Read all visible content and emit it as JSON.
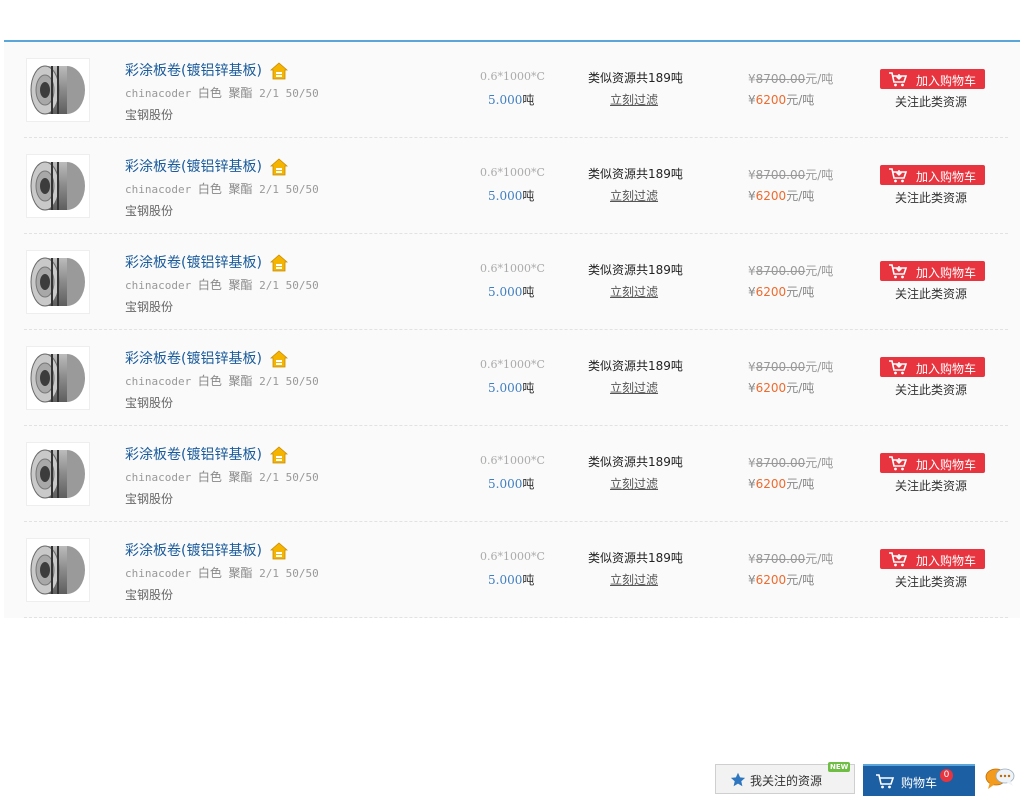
{
  "items": [
    {
      "title": "彩涂板卷(镀铝锌基板)",
      "spec_code": "chinacoder",
      "spec_color": "白色",
      "spec_coating": "聚酯",
      "spec_tail": "2/1 50/50",
      "brand": "宝钢股份",
      "dims": "0.6*1000*C",
      "qty": "5.000",
      "qty_unit": "吨",
      "similar": "类似资源共189吨",
      "filter": "立刻过滤",
      "old_price_sym": "¥",
      "old_price": "8700.00",
      "old_price_unit": "元/吨",
      "new_price_sym": "¥",
      "new_price": "6200",
      "new_price_unit": "元/吨",
      "cart_label": "加入购物车",
      "follow_label": "关注此类资源"
    },
    {
      "title": "彩涂板卷(镀铝锌基板)",
      "spec_code": "chinacoder",
      "spec_color": "白色",
      "spec_coating": "聚酯",
      "spec_tail": "2/1 50/50",
      "brand": "宝钢股份",
      "dims": "0.6*1000*C",
      "qty": "5.000",
      "qty_unit": "吨",
      "similar": "类似资源共189吨",
      "filter": "立刻过滤",
      "old_price_sym": "¥",
      "old_price": "8700.00",
      "old_price_unit": "元/吨",
      "new_price_sym": "¥",
      "new_price": "6200",
      "new_price_unit": "元/吨",
      "cart_label": "加入购物车",
      "follow_label": "关注此类资源"
    },
    {
      "title": "彩涂板卷(镀铝锌基板)",
      "spec_code": "chinacoder",
      "spec_color": "白色",
      "spec_coating": "聚酯",
      "spec_tail": "2/1 50/50",
      "brand": "宝钢股份",
      "dims": "0.6*1000*C",
      "qty": "5.000",
      "qty_unit": "吨",
      "similar": "类似资源共189吨",
      "filter": "立刻过滤",
      "old_price_sym": "¥",
      "old_price": "8700.00",
      "old_price_unit": "元/吨",
      "new_price_sym": "¥",
      "new_price": "6200",
      "new_price_unit": "元/吨",
      "cart_label": "加入购物车",
      "follow_label": "关注此类资源"
    },
    {
      "title": "彩涂板卷(镀铝锌基板)",
      "spec_code": "chinacoder",
      "spec_color": "白色",
      "spec_coating": "聚酯",
      "spec_tail": "2/1 50/50",
      "brand": "宝钢股份",
      "dims": "0.6*1000*C",
      "qty": "5.000",
      "qty_unit": "吨",
      "similar": "类似资源共189吨",
      "filter": "立刻过滤",
      "old_price_sym": "¥",
      "old_price": "8700.00",
      "old_price_unit": "元/吨",
      "new_price_sym": "¥",
      "new_price": "6200",
      "new_price_unit": "元/吨",
      "cart_label": "加入购物车",
      "follow_label": "关注此类资源"
    },
    {
      "title": "彩涂板卷(镀铝锌基板)",
      "spec_code": "chinacoder",
      "spec_color": "白色",
      "spec_coating": "聚酯",
      "spec_tail": "2/1 50/50",
      "brand": "宝钢股份",
      "dims": "0.6*1000*C",
      "qty": "5.000",
      "qty_unit": "吨",
      "similar": "类似资源共189吨",
      "filter": "立刻过滤",
      "old_price_sym": "¥",
      "old_price": "8700.00",
      "old_price_unit": "元/吨",
      "new_price_sym": "¥",
      "new_price": "6200",
      "new_price_unit": "元/吨",
      "cart_label": "加入购物车",
      "follow_label": "关注此类资源"
    },
    {
      "title": "彩涂板卷(镀铝锌基板)",
      "spec_code": "chinacoder",
      "spec_color": "白色",
      "spec_coating": "聚酯",
      "spec_tail": "2/1 50/50",
      "brand": "宝钢股份",
      "dims": "0.6*1000*C",
      "qty": "5.000",
      "qty_unit": "吨",
      "similar": "类似资源共189吨",
      "filter": "立刻过滤",
      "old_price_sym": "¥",
      "old_price": "8700.00",
      "old_price_unit": "元/吨",
      "new_price_sym": "¥",
      "new_price": "6200",
      "new_price_unit": "元/吨",
      "cart_label": "加入购物车",
      "follow_label": "关注此类资源"
    }
  ],
  "item_icons": {
    "thumb": "steel-coil-icon",
    "badge": "home-badge-icon",
    "cart": "cart-icon"
  },
  "footer": {
    "favorites_label": "我关注的资源",
    "favorites_badge": "NEW",
    "cart_label": "购物车",
    "cart_count": "0",
    "icons": {
      "favorites": "star-icon",
      "cart": "cart-icon",
      "chat": "chat-bubbles-icon"
    }
  },
  "colors": {
    "accent_blue": "#5aa6da",
    "title_blue": "#1a5b9c",
    "cart_red": "#e8343f",
    "price_orange": "#ef6a2d",
    "cart_bar": "#1d5fa3",
    "new_green": "#6fbe44"
  }
}
